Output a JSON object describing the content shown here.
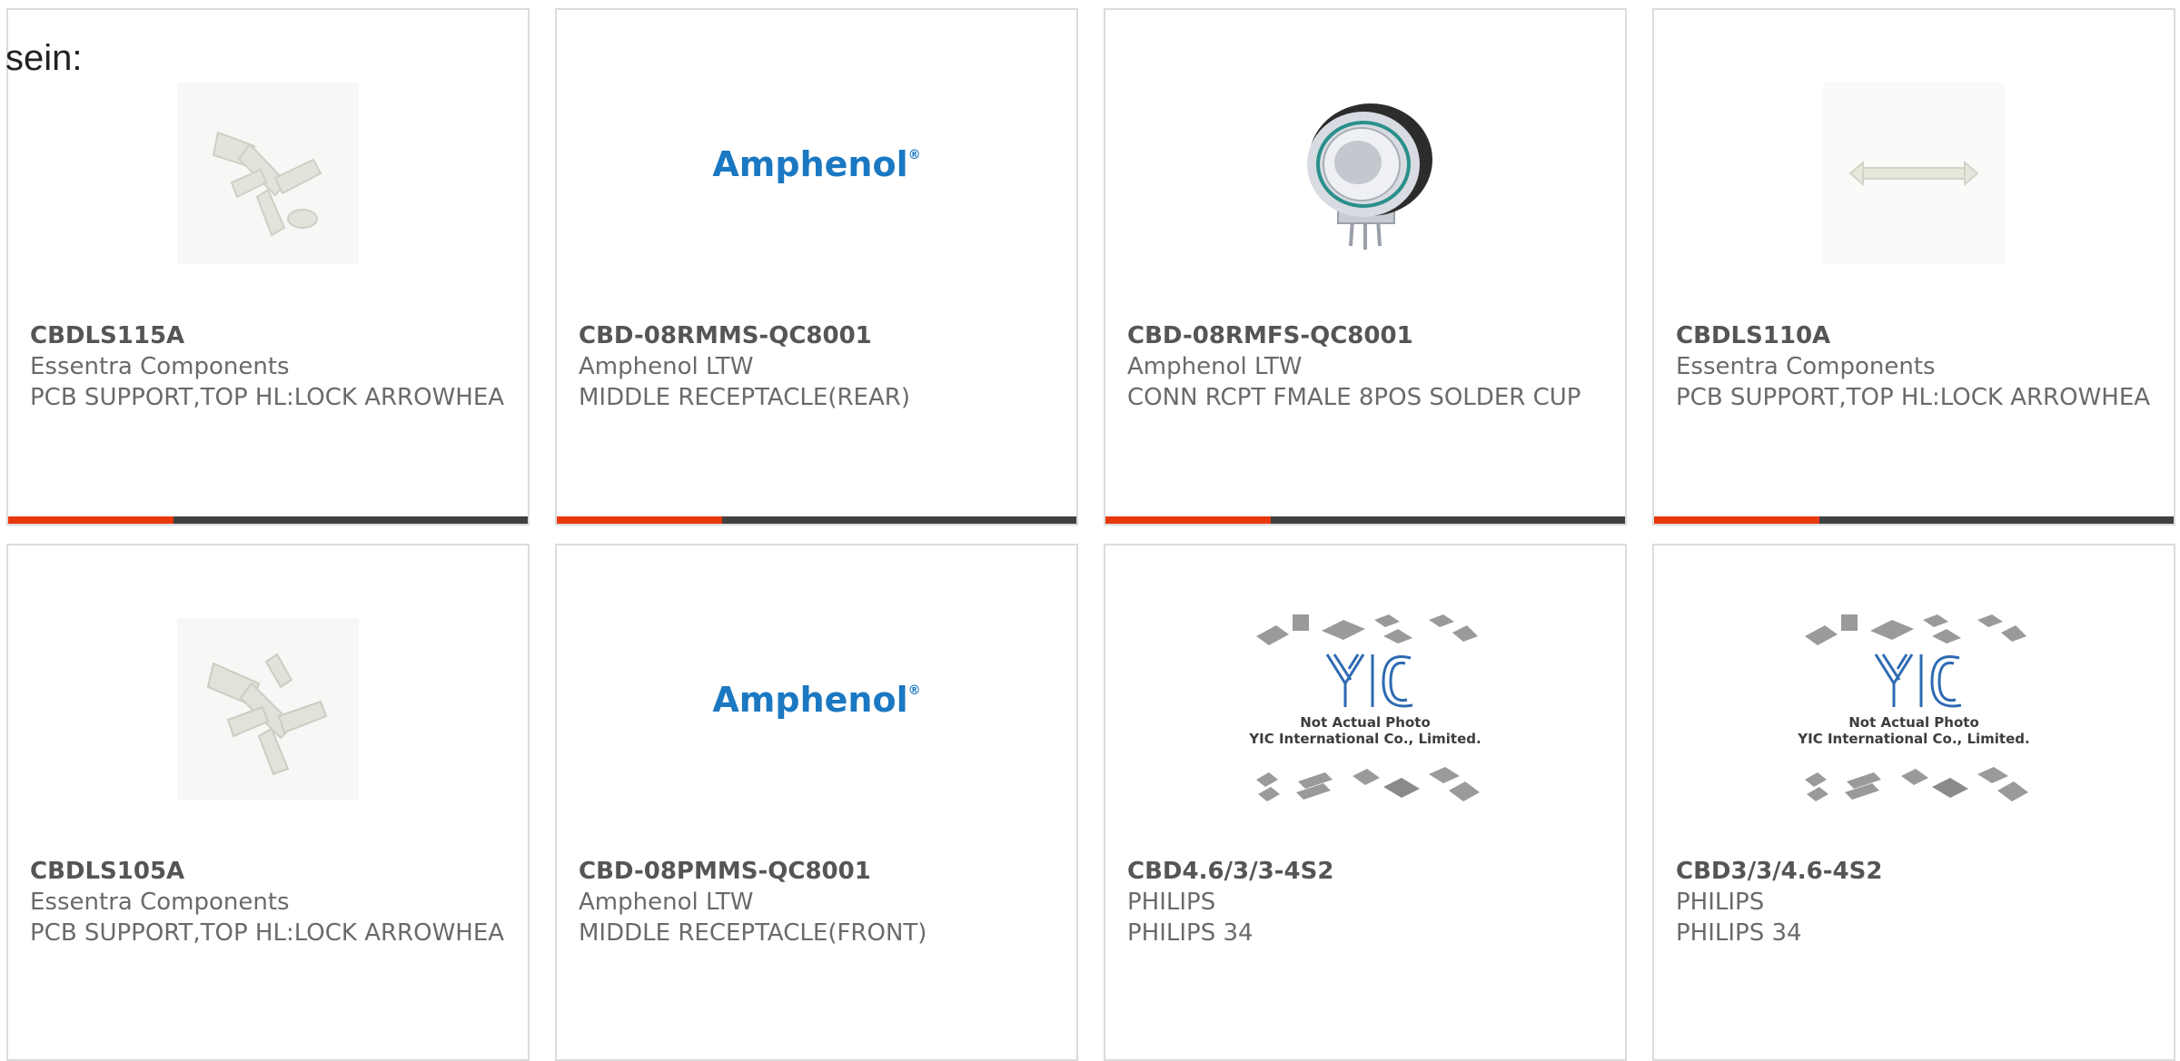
{
  "intro_text": "sein:",
  "colors": {
    "accent_red": "#e8380d",
    "accent_dark": "#404040",
    "amphenol_blue": "#1b78c2"
  },
  "products": [
    {
      "part": "CBDLS115A",
      "manufacturer": "Essentra Components",
      "description": "PCB SUPPORT,TOP HL:LOCK ARROWHEA",
      "image": "pcb-support-clip-photo"
    },
    {
      "part": "CBD-08RMMS-QC8001",
      "manufacturer": "Amphenol LTW",
      "description": "MIDDLE RECEPTACLE(REAR)",
      "image": "amphenol-logo",
      "logo_text": "Amphenol",
      "logo_mark": "®"
    },
    {
      "part": "CBD-08RMFS-QC8001",
      "manufacturer": "Amphenol LTW",
      "description": "CONN RCPT FMALE 8POS SOLDER CUP",
      "image": "circular-connector-photo"
    },
    {
      "part": "CBDLS110A",
      "manufacturer": "Essentra Components",
      "description": "PCB SUPPORT,TOP HL:LOCK ARROWHEA",
      "image": "pcb-support-standoff-photo"
    },
    {
      "part": "CBDLS105A",
      "manufacturer": "Essentra Components",
      "description": "PCB SUPPORT,TOP HL:LOCK ARROWHEA",
      "image": "pcb-support-clip-photo"
    },
    {
      "part": "CBD-08PMMS-QC8001",
      "manufacturer": "Amphenol LTW",
      "description": "MIDDLE RECEPTACLE(FRONT)",
      "image": "amphenol-logo",
      "logo_text": "Amphenol",
      "logo_mark": "®"
    },
    {
      "part": "CBD4.6/3/3-4S2",
      "manufacturer": "PHILIPS",
      "description": "PHILIPS 34",
      "image": "yic-placeholder",
      "placeholder_line1": "Not Actual Photo",
      "placeholder_line2": "YIC International Co., Limited."
    },
    {
      "part": "CBD3/3/4.6-4S2",
      "manufacturer": "PHILIPS",
      "description": "PHILIPS 34",
      "image": "yic-placeholder",
      "placeholder_line1": "Not Actual Photo",
      "placeholder_line2": "YIC International Co., Limited."
    }
  ]
}
